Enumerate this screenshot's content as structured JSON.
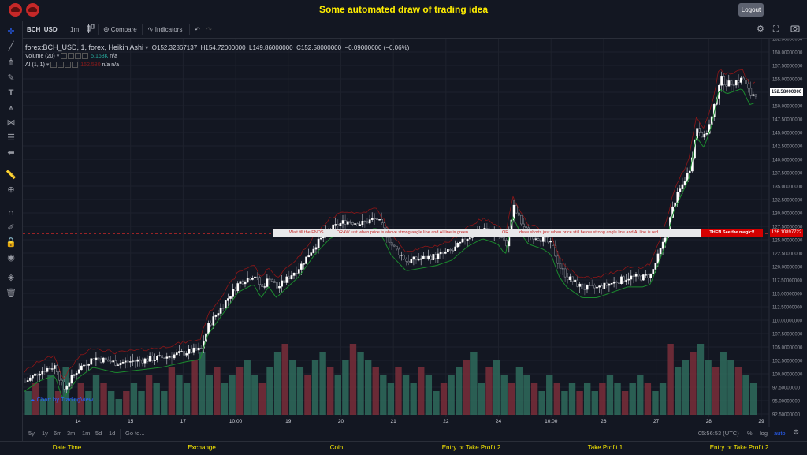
{
  "app": {
    "title": "Some automated draw of trading idea",
    "logout_label": "Logout",
    "accent_color": "#ffee00"
  },
  "toolbar": {
    "symbol": "BCH_USD",
    "interval": "1m",
    "compare_label": "Compare",
    "indicators_label": "Indicators",
    "icons": [
      "candles-icon",
      "compare-icon",
      "indicators-icon",
      "undo-icon",
      "redo-icon",
      "settings-icon",
      "fullscreen-icon",
      "camera-icon"
    ]
  },
  "left_tools": [
    "crosshair-icon",
    "trend-line-icon",
    "pitchfork-icon",
    "brush-icon",
    "text-icon",
    "pattern-icon",
    "forecast-icon",
    "arrow-left-icon",
    "ruler-icon",
    "zoom-icon",
    "magnet-icon",
    "pencil-lock-icon",
    "lock-icon",
    "eye-icon",
    "layers-icon",
    "trash-icon"
  ],
  "legend": {
    "main": "forex:BCH_USD, 1, forex, Heikin Ashi",
    "open": "O152.32867137",
    "high": "H154.72000000",
    "low": "L149.86000000",
    "close": "C152.58000000",
    "change": "−0.09000000 (−0.06%)",
    "volume_label": "Volume (20)",
    "volume_value": "5.163K",
    "volume_na": "n/a",
    "ai_label": "AI (1, 1)",
    "ai_value": "152.580",
    "ai_na1": "n/a",
    "ai_na2": "n/a"
  },
  "annotation": {
    "texts": [
      "Wait till the ENDS",
      "DRAW just when price is above strong angle line and AI line is green",
      "OR",
      "draw shorts just when price still below strong angle line and AI line is red"
    ],
    "magic": "THEN See the magic!!",
    "price_label": "126.10897722"
  },
  "chart_data": {
    "type": "candlestick",
    "style": "Heikin Ashi",
    "symbol": "BCH_USD",
    "y_ticks": [
      "162.50000000",
      "160.00000000",
      "157.50000000",
      "155.00000000",
      "152.50000000",
      "150.00000000",
      "147.50000000",
      "145.00000000",
      "142.50000000",
      "140.00000000",
      "137.50000000",
      "135.00000000",
      "132.50000000",
      "130.00000000",
      "127.50000000",
      "125.00000000",
      "122.50000000",
      "120.00000000",
      "117.50000000",
      "115.00000000",
      "112.50000000",
      "110.00000000",
      "107.50000000",
      "105.00000000",
      "102.50000000",
      "100.00000000",
      "97.50000000",
      "95.00000000",
      "92.50000000"
    ],
    "ylim": [
      92.5,
      162.5
    ],
    "x_ticks": [
      "14",
      "15",
      "17",
      "10:00",
      "19",
      "20",
      "21",
      "22",
      "24",
      "10:00",
      "26",
      "27",
      "28",
      "29"
    ],
    "last_price": "152.58000000",
    "price_path": [
      [
        0,
        98.5
      ],
      [
        2,
        100.5
      ],
      [
        4,
        101.5
      ],
      [
        5,
        97
      ],
      [
        7,
        101
      ],
      [
        9,
        103
      ],
      [
        12,
        102
      ],
      [
        15,
        102.5
      ],
      [
        18,
        103
      ],
      [
        21,
        104
      ],
      [
        23,
        104.5
      ],
      [
        24,
        109
      ],
      [
        26,
        113
      ],
      [
        28,
        117
      ],
      [
        30,
        118.5
      ],
      [
        31,
        116
      ],
      [
        32,
        118
      ],
      [
        33,
        116
      ],
      [
        36,
        120
      ],
      [
        38,
        124
      ],
      [
        40,
        127
      ],
      [
        42,
        128.5
      ],
      [
        44,
        128
      ],
      [
        46,
        129
      ],
      [
        47,
        127
      ],
      [
        48,
        124
      ],
      [
        50,
        121
      ],
      [
        52,
        121.5
      ],
      [
        54,
        122
      ],
      [
        56,
        123
      ],
      [
        58,
        125.5
      ],
      [
        60,
        127
      ],
      [
        62,
        126
      ],
      [
        63,
        124
      ],
      [
        64,
        131
      ],
      [
        65,
        128
      ],
      [
        66,
        126
      ],
      [
        68,
        125
      ],
      [
        69,
        124
      ],
      [
        70,
        120
      ],
      [
        71,
        118
      ],
      [
        73,
        116
      ],
      [
        75,
        116
      ],
      [
        77,
        117
      ],
      [
        79,
        118
      ],
      [
        81,
        118
      ],
      [
        82,
        118.5
      ],
      [
        84,
        126
      ],
      [
        85,
        132
      ],
      [
        87,
        138
      ],
      [
        88,
        146
      ],
      [
        89,
        144
      ],
      [
        90,
        148
      ],
      [
        91,
        155
      ],
      [
        92,
        154
      ],
      [
        94,
        155
      ],
      [
        95,
        152
      ],
      [
        96,
        152.5
      ]
    ],
    "volume": [
      3,
      4,
      2,
      5,
      3,
      6,
      2,
      4,
      3,
      5,
      4,
      3,
      2,
      3,
      4,
      3,
      5,
      4,
      3,
      6,
      5,
      4,
      7,
      8,
      5,
      6,
      4,
      5,
      6,
      7,
      5,
      4,
      6,
      8,
      9,
      7,
      6,
      5,
      7,
      8,
      6,
      5,
      7,
      9,
      8,
      7,
      6,
      5,
      4,
      6,
      5,
      4,
      6,
      5,
      3,
      4,
      5,
      6,
      7,
      8,
      4,
      6,
      7,
      5,
      4,
      6,
      5,
      4,
      3,
      5,
      4,
      3,
      4,
      3,
      4,
      3,
      4,
      5,
      4,
      3,
      4,
      5,
      4,
      3,
      4,
      9,
      6,
      7,
      8,
      9,
      7,
      6,
      8,
      7,
      6,
      5,
      4
    ]
  },
  "bottom": {
    "ranges": [
      "5y",
      "1y",
      "6m",
      "3m",
      "1m",
      "5d",
      "1d"
    ],
    "goto": "Go to...",
    "time": "05:56:53 (UTC)",
    "pct": "%",
    "log": "log",
    "auto": "auto",
    "tv_badge": "Chart by TradingView"
  },
  "footer": [
    "Date Time",
    "Exchange",
    "Coin",
    "Entry or Take Profit 2",
    "Take Profit 1",
    "Entry or Take Profit 2"
  ]
}
